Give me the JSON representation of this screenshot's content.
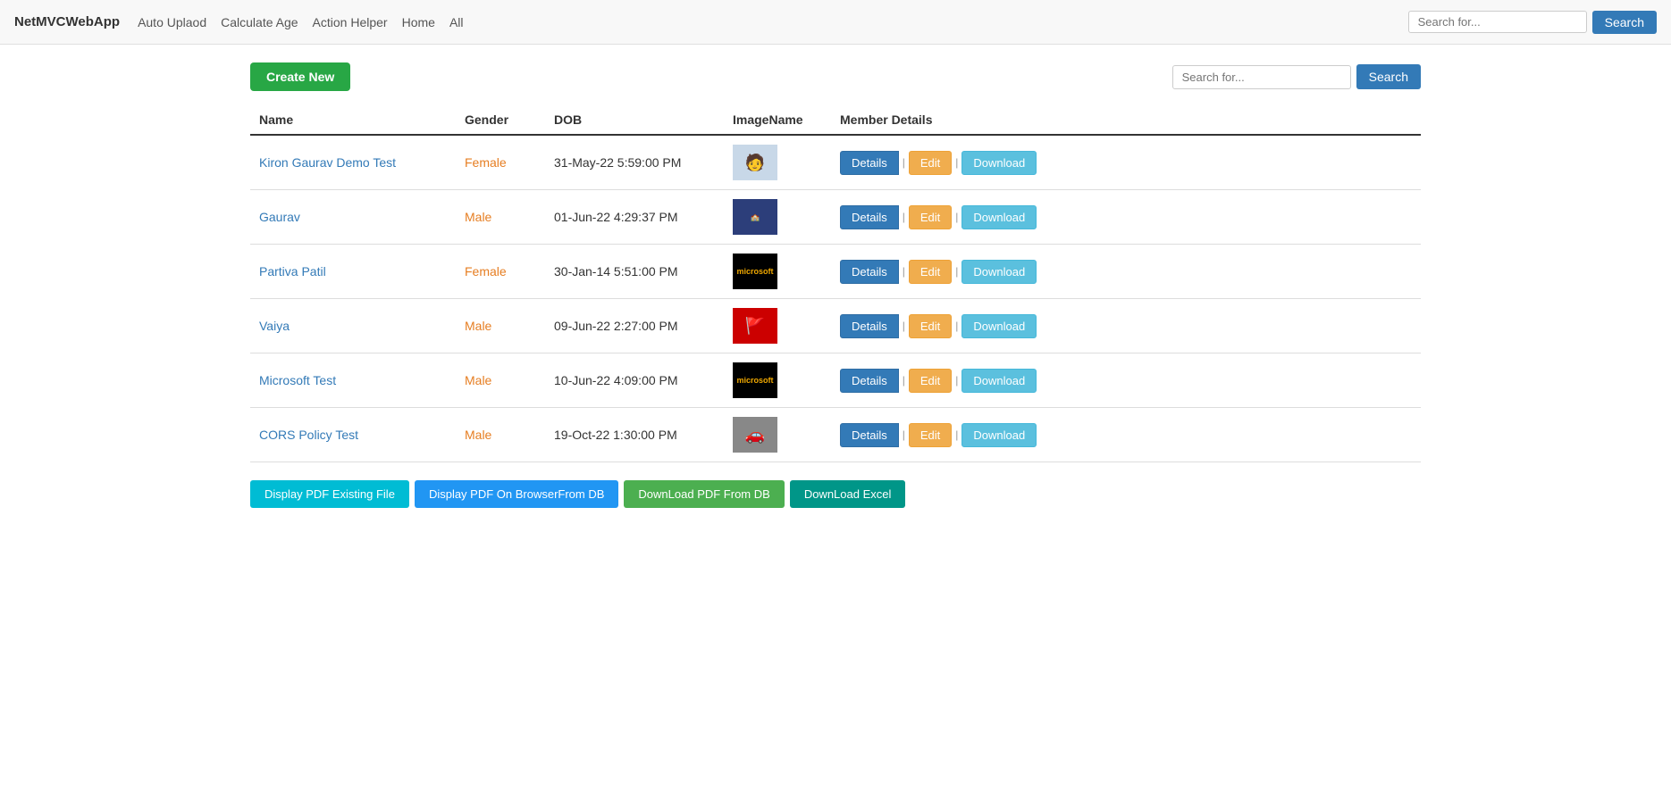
{
  "navbar": {
    "brand": "NetMVCWebApp",
    "links": [
      {
        "label": "Auto Uplaod",
        "href": "#"
      },
      {
        "label": "Calculate Age",
        "href": "#"
      },
      {
        "label": "Action Helper",
        "href": "#"
      },
      {
        "label": "Home",
        "href": "#"
      },
      {
        "label": "All",
        "href": "#"
      }
    ],
    "search_placeholder": "Search for...",
    "search_button": "Search"
  },
  "toolbar": {
    "create_new_label": "Create New",
    "search_placeholder": "Search for...",
    "search_button": "Search"
  },
  "table": {
    "headers": {
      "name": "Name",
      "gender": "Gender",
      "dob": "DOB",
      "image_name": "ImageName",
      "member_details": "Member Details"
    },
    "rows": [
      {
        "name": "Kiron Gaurav Demo Test",
        "gender": "Female",
        "gender_class": "gender-female",
        "dob": "31-May-22 5:59:00 PM",
        "image_type": "person",
        "details_label": "Details",
        "edit_label": "Edit",
        "download_label": "Download"
      },
      {
        "name": "Gaurav",
        "gender": "Male",
        "gender_class": "gender-male",
        "dob": "01-Jun-22 4:29:37 PM",
        "image_type": "badge",
        "details_label": "Details",
        "edit_label": "Edit",
        "download_label": "Download"
      },
      {
        "name": "Partiva Patil",
        "gender": "Female",
        "gender_class": "gender-female",
        "dob": "30-Jan-14 5:51:00 PM",
        "image_type": "microsoft",
        "details_label": "Details",
        "edit_label": "Edit",
        "download_label": "Download"
      },
      {
        "name": "Vaiya",
        "gender": "Male",
        "gender_class": "gender-male",
        "dob": "09-Jun-22 2:27:00 PM",
        "image_type": "flag",
        "details_label": "Details",
        "edit_label": "Edit",
        "download_label": "Download"
      },
      {
        "name": "Microsoft Test",
        "gender": "Male",
        "gender_class": "gender-male",
        "dob": "10-Jun-22 4:09:00 PM",
        "image_type": "microsoft",
        "details_label": "Details",
        "edit_label": "Edit",
        "download_label": "Download"
      },
      {
        "name": "CORS Policy Test",
        "gender": "Male",
        "gender_class": "gender-male",
        "dob": "19-Oct-22 1:30:00 PM",
        "image_type": "tank",
        "details_label": "Details",
        "edit_label": "Edit",
        "download_label": "Download"
      }
    ]
  },
  "bottom_buttons": {
    "display_pdf_existing": "Display PDF Existing File",
    "display_pdf_browser": "Display PDF On BrowserFrom DB",
    "download_pdf_db": "DownLoad PDF From DB",
    "download_excel": "DownLoad Excel"
  }
}
